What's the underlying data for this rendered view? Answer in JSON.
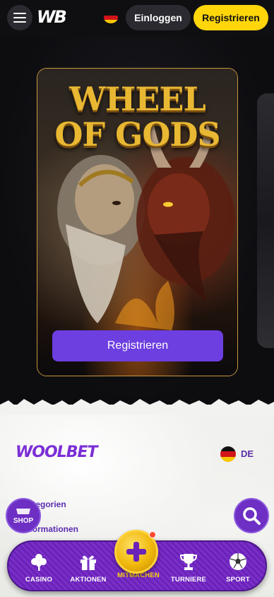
{
  "header": {
    "menu_icon": "hamburger-icon",
    "logo": "WB",
    "login_label": "Einloggen",
    "register_label": "Registrieren"
  },
  "hero": {
    "game_title_line1": "WHEEL",
    "game_title_line2": "OF GODS",
    "register_label": "Registrieren"
  },
  "footer": {
    "logo": "WOOLBET",
    "language_code": "DE",
    "links": [
      "Kategorien",
      "Informationen"
    ],
    "shop_label": "SHOP"
  },
  "nav": {
    "items": [
      {
        "label": "CASINO",
        "icon": "clover-icon"
      },
      {
        "label": "AKTIONEN",
        "icon": "gift-icon"
      },
      {
        "label": "MITMACHEN",
        "icon": "plus-icon"
      },
      {
        "label": "TURNIERE",
        "icon": "trophy-icon"
      },
      {
        "label": "SPORT",
        "icon": "soccer-ball-icon"
      }
    ]
  },
  "colors": {
    "accent_yellow": "#ffd60a",
    "accent_purple": "#6d3ee0",
    "card_border": "#c9973f"
  }
}
